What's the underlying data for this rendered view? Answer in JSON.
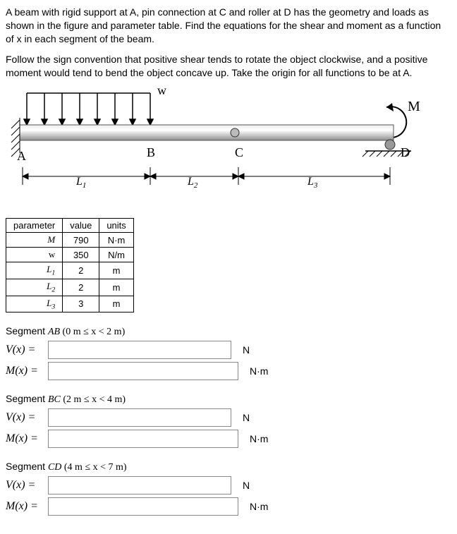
{
  "problem": {
    "p1": "A beam with rigid support at A, pin connection at C and roller at D has the geometry and loads as shown in the figure and parameter table. Find the equations for the shear and moment as a function of x in each segment of the beam.",
    "p2": "Follow the sign convention that positive shear tends to rotate the object clockwise, and a positive moment would tend to bend the object concave up. Take the origin for all functions to be at A."
  },
  "figure": {
    "w_label": "w",
    "M_label": "M",
    "A": "A",
    "B": "B",
    "C": "C",
    "D": "D",
    "L1": "L",
    "L1_sub": "1",
    "L2": "L",
    "L2_sub": "2",
    "L3": "L",
    "L3_sub": "3"
  },
  "table": {
    "head_parameter": "parameter",
    "head_value": "value",
    "head_units": "units",
    "rows": [
      {
        "param_html": "M",
        "param_sub": "",
        "value": "790",
        "units": "N·m"
      },
      {
        "param_html": "w",
        "param_sub": "",
        "value": "350",
        "units": "N/m"
      },
      {
        "param_html": "L",
        "param_sub": "1",
        "value": "2",
        "units": "m"
      },
      {
        "param_html": "L",
        "param_sub": "2",
        "value": "2",
        "units": "m"
      },
      {
        "param_html": "L",
        "param_sub": "3",
        "value": "3",
        "units": "m"
      }
    ]
  },
  "segments": {
    "AB": {
      "title_pre": "Segment ",
      "title_seg": "AB",
      "title_range": " (0 m  ≤ x <  2 m)",
      "V_label": "V(x) =",
      "V_value": "",
      "V_unit": "N",
      "M_label": "M(x) =",
      "M_value": "",
      "M_unit": "N·m"
    },
    "BC": {
      "title_pre": "Segment ",
      "title_seg": "BC",
      "title_range": " (2 m  ≤ x <  4 m)",
      "V_label": "V(x) =",
      "V_value": "",
      "V_unit": "N",
      "M_label": "M(x) =",
      "M_value": "",
      "M_unit": "N·m"
    },
    "CD": {
      "title_pre": "Segment ",
      "title_seg": "CD",
      "title_range": " (4 m  ≤ x <  7 m)",
      "V_label": "V(x) =",
      "V_value": "",
      "V_unit": "N",
      "M_label": "M(x) =",
      "M_value": "",
      "M_unit": "N·m"
    }
  }
}
